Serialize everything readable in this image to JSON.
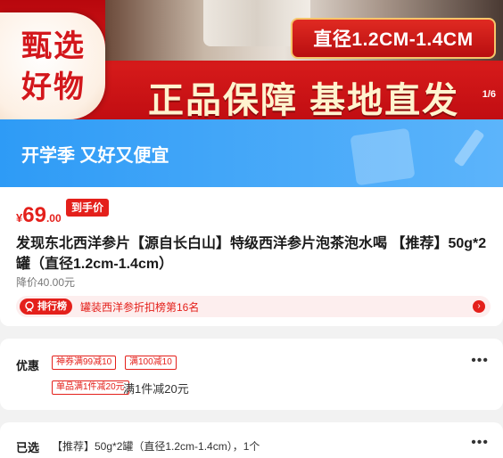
{
  "hero": {
    "spec_badge": "直径1.2CM-1.4CM",
    "select_line1": "甄选",
    "select_line2": "好物",
    "slogan": "正品保障 基地直发",
    "page_indicator": "1/6"
  },
  "promo": {
    "text": "开学季 又好又便宜"
  },
  "product": {
    "price_symbol": "¥",
    "price_int": "69",
    "price_dec": ".00",
    "arrive_tag": "到手价",
    "title": "发现东北西洋参片【源自长白山】特级西洋参片泡茶泡水喝 【推荐】50g*2罐（直径1.2cm-1.4cm）",
    "orig_price": "降价40.00元",
    "rank_badge": "排行榜",
    "rank_text": "罐装西洋参折扣榜第16名",
    "rank_arrow": "›"
  },
  "coupons": {
    "label": "优惠",
    "tags": [
      "神券满99减10",
      "满100减10",
      "单品满1件减20元"
    ],
    "desc": "满1件减20元",
    "more": "•••"
  },
  "selected": {
    "label": "已选",
    "value": "【推荐】50g*2罐（直径1.2cm-1.4cm），1个",
    "more": "•••"
  },
  "colors": {
    "accent_red": "#e4201b",
    "promo_blue": "#2e9bf6"
  }
}
